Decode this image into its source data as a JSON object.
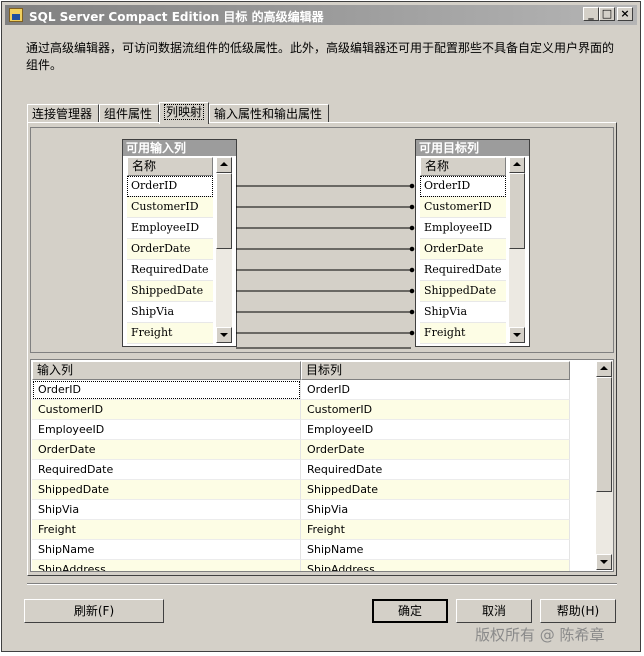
{
  "window": {
    "title": "SQL Server Compact Edition 目标 的高级编辑器",
    "min_glyph": "_",
    "max_glyph": "□",
    "close_glyph": "×"
  },
  "description": "通过高级编辑器，可访问数据流组件的低级属性。此外，高级编辑器还可用于配置那些不具备自定义用户界面的组件。",
  "tabs": [
    {
      "label": "连接管理器"
    },
    {
      "label": "组件属性"
    },
    {
      "label": "列映射",
      "active": true
    },
    {
      "label": "输入属性和输出属性"
    }
  ],
  "input_box": {
    "title": "可用输入列",
    "column_header": "名称",
    "rows": [
      "OrderID",
      "CustomerID",
      "EmployeeID",
      "OrderDate",
      "RequiredDate",
      "ShippedDate",
      "ShipVia",
      "Freight"
    ]
  },
  "target_box": {
    "title": "可用目标列",
    "column_header": "名称",
    "rows": [
      "OrderID",
      "CustomerID",
      "EmployeeID",
      "OrderDate",
      "RequiredDate",
      "ShippedDate",
      "ShipVia",
      "Freight"
    ]
  },
  "grid": {
    "headers": [
      "输入列",
      "目标列"
    ],
    "rows": [
      [
        "OrderID",
        "OrderID"
      ],
      [
        "CustomerID",
        "CustomerID"
      ],
      [
        "EmployeeID",
        "EmployeeID"
      ],
      [
        "OrderDate",
        "OrderDate"
      ],
      [
        "RequiredDate",
        "RequiredDate"
      ],
      [
        "ShippedDate",
        "ShippedDate"
      ],
      [
        "ShipVia",
        "ShipVia"
      ],
      [
        "Freight",
        "Freight"
      ],
      [
        "ShipName",
        "ShipName"
      ],
      [
        "ShipAddress",
        "ShipAddress"
      ]
    ]
  },
  "buttons": {
    "refresh": "刷新(F)",
    "ok": "确定",
    "cancel": "取消",
    "help": "帮助(H)"
  },
  "watermark": "版权所有 @ 陈希章",
  "colors": {
    "title_bar": "#808080",
    "face": "#d4d0c8",
    "alt_row": "#fdfde5"
  }
}
